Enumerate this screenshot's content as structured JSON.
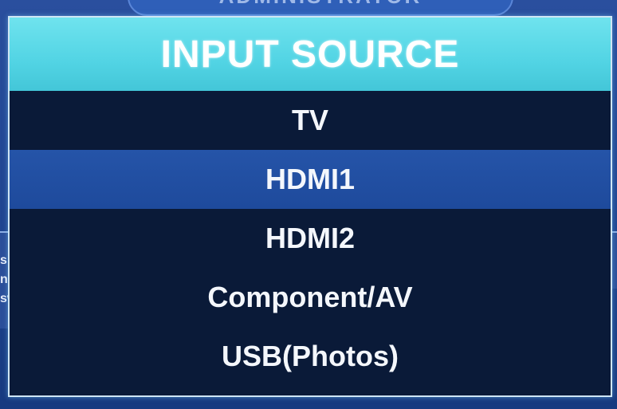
{
  "background": {
    "window_title": "ADMINISTRATOR",
    "left_text_fragments": [
      "s",
      "na",
      "sw"
    ]
  },
  "osd_menu": {
    "title": "INPUT SOURCE",
    "items": [
      {
        "label": "TV",
        "selected": false
      },
      {
        "label": "HDMI1",
        "selected": true
      },
      {
        "label": "HDMI2",
        "selected": false
      },
      {
        "label": "Component/AV",
        "selected": false
      },
      {
        "label": "USB(Photos)",
        "selected": false
      }
    ]
  },
  "colors": {
    "header_accent": "#52d4e4",
    "menu_background": "#0a1a38",
    "selection_highlight": "#1e4a9c",
    "screen_background": "#1f4591"
  }
}
